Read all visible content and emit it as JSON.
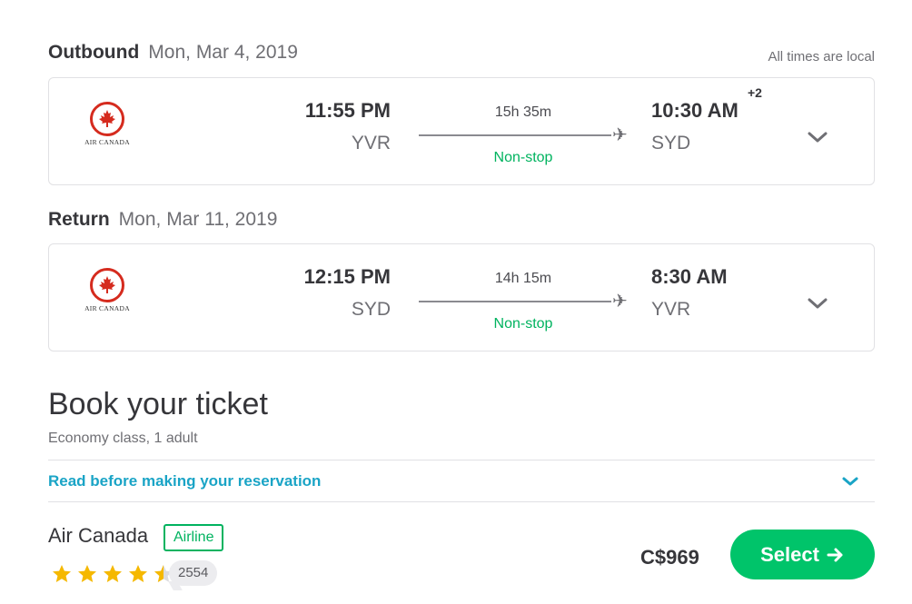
{
  "notice": {
    "times_local": "All times are local"
  },
  "outbound": {
    "label": "Outbound",
    "date": "Mon, Mar 4, 2019",
    "airline_logo_text": "AIR CANADA",
    "depart_time": "11:55 PM",
    "depart_code": "YVR",
    "duration": "15h 35m",
    "stops": "Non-stop",
    "arrive_time": "10:30 AM",
    "arrive_code": "SYD",
    "day_offset": "+2"
  },
  "return": {
    "label": "Return",
    "date": "Mon, Mar 11, 2019",
    "airline_logo_text": "AIR CANADA",
    "depart_time": "12:15 PM",
    "depart_code": "SYD",
    "duration": "14h 15m",
    "stops": "Non-stop",
    "arrive_time": "8:30 AM",
    "arrive_code": "YVR"
  },
  "booking": {
    "title": "Book your ticket",
    "subtitle": "Economy class, 1 adult",
    "read_link": "Read before making your reservation"
  },
  "offer": {
    "provider": "Air Canada",
    "badge": "Airline",
    "rating": 4.5,
    "rating_max": 5,
    "review_count": "2554",
    "price": "C$969",
    "select_label": "Select"
  },
  "colors": {
    "accent_green": "#00c46a",
    "nonstop_green": "#00b35f",
    "link_blue": "#1aa4c6",
    "star_yellow": "#f5b800",
    "air_canada_red": "#d52b1e"
  },
  "icons": {
    "plane": "plane-icon",
    "chevron": "chevron-down-icon",
    "arrow": "arrow-right-icon",
    "star": "star-icon",
    "logo": "maple-leaf-icon"
  }
}
